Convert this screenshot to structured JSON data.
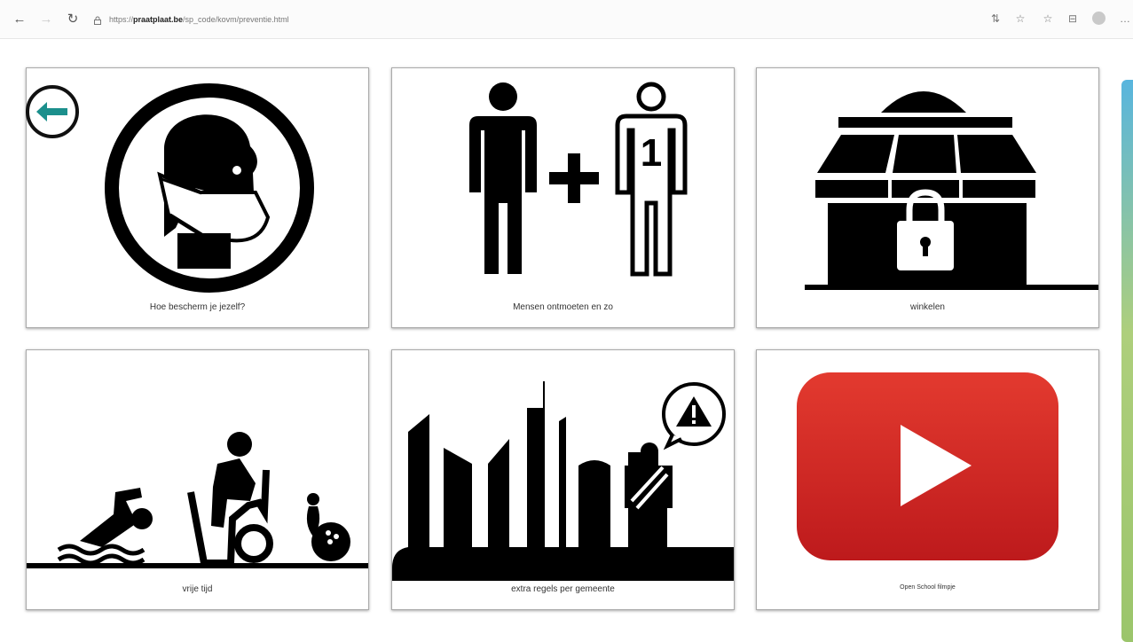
{
  "browser": {
    "url_prefix": "https://",
    "url_host": "praatplaat.be",
    "url_path": "/sp_code/kovm/preventie.html"
  },
  "cards": [
    {
      "label": "Hoe bescherm je jezelf?",
      "icon": "face-mask-icon"
    },
    {
      "label": "Mensen ontmoeten en zo",
      "icon": "person-plus-one-icon"
    },
    {
      "label": "winkelen",
      "icon": "closed-shop-icon"
    },
    {
      "label": "vrije tijd",
      "icon": "leisure-icon"
    },
    {
      "label": "extra regels per gemeente",
      "icon": "city-warning-icon"
    },
    {
      "label": "Open School filmpje",
      "icon": "youtube-play-icon"
    }
  ],
  "colors": {
    "back_arrow": "#1b8f8c",
    "youtube_red": "#d7201e"
  }
}
